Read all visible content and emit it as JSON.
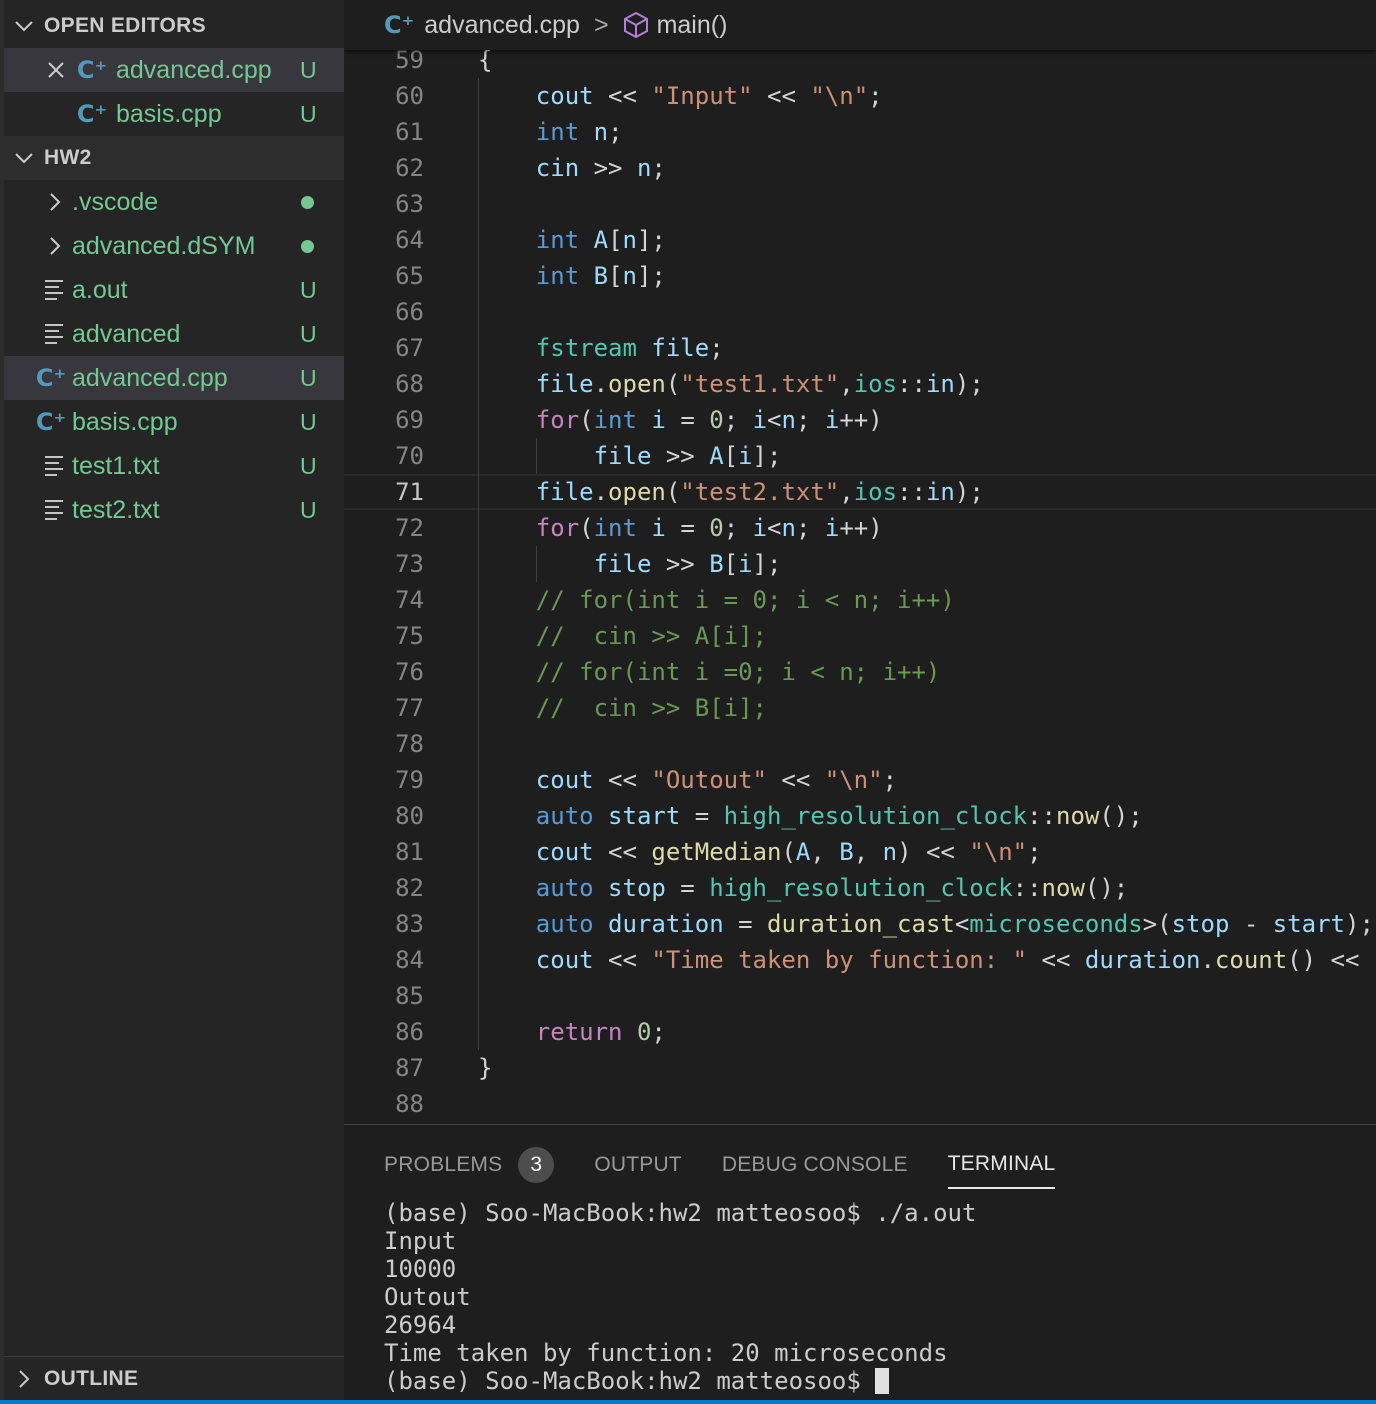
{
  "sidebar": {
    "open_editors": {
      "title": "OPEN EDITORS",
      "items": [
        {
          "name": "advanced.cpp",
          "badge": "U"
        },
        {
          "name": "basis.cpp",
          "badge": "U"
        }
      ]
    },
    "folder": {
      "title": "HW2",
      "items": [
        {
          "name": ".vscode",
          "kind": "folder",
          "status": "modified-dot"
        },
        {
          "name": "advanced.dSYM",
          "kind": "folder",
          "status": "modified-dot"
        },
        {
          "name": "a.out",
          "kind": "file",
          "badge": "U"
        },
        {
          "name": "advanced",
          "kind": "file",
          "badge": "U"
        },
        {
          "name": "advanced.cpp",
          "kind": "cpp",
          "badge": "U",
          "selected": true
        },
        {
          "name": "basis.cpp",
          "kind": "cpp",
          "badge": "U"
        },
        {
          "name": "test1.txt",
          "kind": "file",
          "badge": "U"
        },
        {
          "name": "test2.txt",
          "kind": "file",
          "badge": "U"
        }
      ]
    },
    "outline": {
      "title": "OUTLINE"
    }
  },
  "breadcrumb": {
    "file": "advanced.cpp",
    "separator": ">",
    "symbol": "main()"
  },
  "editor": {
    "current_line": 71,
    "lines": [
      {
        "n": "59",
        "ind": 0,
        "t": [
          [
            "p",
            "{"
          ]
        ]
      },
      {
        "n": "60",
        "ind": 1,
        "t": [
          [
            "var",
            "cout"
          ],
          [
            "p",
            " << "
          ],
          [
            "str",
            "\"Input\""
          ],
          [
            "p",
            " << "
          ],
          [
            "str",
            "\"\\n\""
          ],
          [
            "p",
            ";"
          ]
        ]
      },
      {
        "n": "61",
        "ind": 1,
        "t": [
          [
            "kw",
            "int"
          ],
          [
            "p",
            " "
          ],
          [
            "var",
            "n"
          ],
          [
            "p",
            ";"
          ]
        ]
      },
      {
        "n": "62",
        "ind": 1,
        "t": [
          [
            "var",
            "cin"
          ],
          [
            "p",
            " >> "
          ],
          [
            "var",
            "n"
          ],
          [
            "p",
            ";"
          ]
        ]
      },
      {
        "n": "63",
        "ind": 1,
        "t": []
      },
      {
        "n": "64",
        "ind": 1,
        "t": [
          [
            "kw",
            "int"
          ],
          [
            "p",
            " "
          ],
          [
            "var",
            "A"
          ],
          [
            "p",
            "["
          ],
          [
            "var",
            "n"
          ],
          [
            "p",
            "];"
          ]
        ]
      },
      {
        "n": "65",
        "ind": 1,
        "t": [
          [
            "kw",
            "int"
          ],
          [
            "p",
            " "
          ],
          [
            "var",
            "B"
          ],
          [
            "p",
            "["
          ],
          [
            "var",
            "n"
          ],
          [
            "p",
            "];"
          ]
        ]
      },
      {
        "n": "66",
        "ind": 1,
        "t": []
      },
      {
        "n": "67",
        "ind": 1,
        "t": [
          [
            "typ",
            "fstream"
          ],
          [
            "p",
            " "
          ],
          [
            "var",
            "file"
          ],
          [
            "p",
            ";"
          ]
        ]
      },
      {
        "n": "68",
        "ind": 1,
        "t": [
          [
            "var",
            "file"
          ],
          [
            "p",
            "."
          ],
          [
            "fn",
            "open"
          ],
          [
            "p",
            "("
          ],
          [
            "str",
            "\"test1.txt\""
          ],
          [
            "p",
            ","
          ],
          [
            "typ",
            "ios"
          ],
          [
            "p",
            "::"
          ],
          [
            "var",
            "in"
          ],
          [
            "p",
            ");"
          ]
        ]
      },
      {
        "n": "69",
        "ind": 1,
        "t": [
          [
            "ctl",
            "for"
          ],
          [
            "p",
            "("
          ],
          [
            "kw",
            "int"
          ],
          [
            "p",
            " "
          ],
          [
            "var",
            "i"
          ],
          [
            "p",
            " = "
          ],
          [
            "num",
            "0"
          ],
          [
            "p",
            "; "
          ],
          [
            "var",
            "i"
          ],
          [
            "p",
            "<"
          ],
          [
            "var",
            "n"
          ],
          [
            "p",
            "; "
          ],
          [
            "var",
            "i"
          ],
          [
            "p",
            "++)"
          ]
        ]
      },
      {
        "n": "70",
        "ind": 2,
        "t": [
          [
            "var",
            "file"
          ],
          [
            "p",
            " >> "
          ],
          [
            "var",
            "A"
          ],
          [
            "p",
            "["
          ],
          [
            "var",
            "i"
          ],
          [
            "p",
            "];"
          ]
        ]
      },
      {
        "n": "71",
        "ind": 1,
        "t": [
          [
            "var",
            "file"
          ],
          [
            "p",
            "."
          ],
          [
            "fn",
            "open"
          ],
          [
            "p",
            "("
          ],
          [
            "str",
            "\"test2.txt\""
          ],
          [
            "p",
            ","
          ],
          [
            "typ",
            "ios"
          ],
          [
            "p",
            "::"
          ],
          [
            "var",
            "in"
          ],
          [
            "p",
            ");"
          ]
        ]
      },
      {
        "n": "72",
        "ind": 1,
        "t": [
          [
            "ctl",
            "for"
          ],
          [
            "p",
            "("
          ],
          [
            "kw",
            "int"
          ],
          [
            "p",
            " "
          ],
          [
            "var",
            "i"
          ],
          [
            "p",
            " = "
          ],
          [
            "num",
            "0"
          ],
          [
            "p",
            "; "
          ],
          [
            "var",
            "i"
          ],
          [
            "p",
            "<"
          ],
          [
            "var",
            "n"
          ],
          [
            "p",
            "; "
          ],
          [
            "var",
            "i"
          ],
          [
            "p",
            "++)"
          ]
        ]
      },
      {
        "n": "73",
        "ind": 2,
        "t": [
          [
            "var",
            "file"
          ],
          [
            "p",
            " >> "
          ],
          [
            "var",
            "B"
          ],
          [
            "p",
            "["
          ],
          [
            "var",
            "i"
          ],
          [
            "p",
            "];"
          ]
        ]
      },
      {
        "n": "74",
        "ind": 1,
        "t": [
          [
            "cmt",
            "// for(int i = 0; i < n; i++)"
          ]
        ]
      },
      {
        "n": "75",
        "ind": 1,
        "t": [
          [
            "cmt",
            "//  cin >> A[i];"
          ]
        ]
      },
      {
        "n": "76",
        "ind": 1,
        "t": [
          [
            "cmt",
            "// for(int i =0; i < n; i++)"
          ]
        ]
      },
      {
        "n": "77",
        "ind": 1,
        "t": [
          [
            "cmt",
            "//  cin >> B[i];"
          ]
        ]
      },
      {
        "n": "78",
        "ind": 1,
        "t": []
      },
      {
        "n": "79",
        "ind": 1,
        "t": [
          [
            "var",
            "cout"
          ],
          [
            "p",
            " << "
          ],
          [
            "str",
            "\"Outout\""
          ],
          [
            "p",
            " << "
          ],
          [
            "str",
            "\"\\n\""
          ],
          [
            "p",
            ";"
          ]
        ]
      },
      {
        "n": "80",
        "ind": 1,
        "t": [
          [
            "kw",
            "auto"
          ],
          [
            "p",
            " "
          ],
          [
            "var",
            "start"
          ],
          [
            "p",
            " = "
          ],
          [
            "typ",
            "high_resolution_clock"
          ],
          [
            "p",
            "::"
          ],
          [
            "fn",
            "now"
          ],
          [
            "p",
            "();"
          ]
        ]
      },
      {
        "n": "81",
        "ind": 1,
        "t": [
          [
            "var",
            "cout"
          ],
          [
            "p",
            " << "
          ],
          [
            "fn",
            "getMedian"
          ],
          [
            "p",
            "("
          ],
          [
            "var",
            "A"
          ],
          [
            "p",
            ", "
          ],
          [
            "var",
            "B"
          ],
          [
            "p",
            ", "
          ],
          [
            "var",
            "n"
          ],
          [
            "p",
            ") << "
          ],
          [
            "str",
            "\"\\n\""
          ],
          [
            "p",
            ";"
          ]
        ]
      },
      {
        "n": "82",
        "ind": 1,
        "t": [
          [
            "kw",
            "auto"
          ],
          [
            "p",
            " "
          ],
          [
            "var",
            "stop"
          ],
          [
            "p",
            " = "
          ],
          [
            "typ",
            "high_resolution_clock"
          ],
          [
            "p",
            "::"
          ],
          [
            "fn",
            "now"
          ],
          [
            "p",
            "();"
          ]
        ]
      },
      {
        "n": "83",
        "ind": 1,
        "t": [
          [
            "kw",
            "auto"
          ],
          [
            "p",
            " "
          ],
          [
            "var",
            "duration"
          ],
          [
            "p",
            " = "
          ],
          [
            "fn",
            "duration_cast"
          ],
          [
            "p",
            "<"
          ],
          [
            "typ",
            "microseconds"
          ],
          [
            "p",
            ">("
          ],
          [
            "var",
            "stop"
          ],
          [
            "p",
            " - "
          ],
          [
            "var",
            "start"
          ],
          [
            "p",
            ");"
          ]
        ]
      },
      {
        "n": "84",
        "ind": 1,
        "t": [
          [
            "var",
            "cout"
          ],
          [
            "p",
            " << "
          ],
          [
            "str",
            "\"Time taken by function: \""
          ],
          [
            "p",
            " << "
          ],
          [
            "var",
            "duration"
          ],
          [
            "p",
            "."
          ],
          [
            "fn",
            "count"
          ],
          [
            "p",
            "() << "
          ],
          [
            "str",
            "\""
          ]
        ]
      },
      {
        "n": "85",
        "ind": 1,
        "t": []
      },
      {
        "n": "86",
        "ind": 1,
        "t": [
          [
            "ctl",
            "return"
          ],
          [
            "p",
            " "
          ],
          [
            "num",
            "0"
          ],
          [
            "p",
            ";"
          ]
        ]
      },
      {
        "n": "87",
        "ind": 0,
        "t": [
          [
            "p",
            "}"
          ]
        ]
      },
      {
        "n": "88",
        "ind": 0,
        "t": []
      }
    ]
  },
  "panel": {
    "tabs": [
      {
        "label": "PROBLEMS",
        "count": "3"
      },
      {
        "label": "OUTPUT"
      },
      {
        "label": "DEBUG CONSOLE"
      },
      {
        "label": "TERMINAL",
        "active": true
      }
    ],
    "terminal": [
      "(base) Soo-MacBook:hw2 matteosoo$ ./a.out",
      "Input",
      "10000",
      "Outout",
      "26964",
      "Time taken by function: 20 microseconds",
      "(base) Soo-MacBook:hw2 matteosoo$ "
    ]
  },
  "colors": {
    "accent": "#007acc",
    "git_untracked": "#73c991",
    "cpp_icon": "#519aba"
  }
}
